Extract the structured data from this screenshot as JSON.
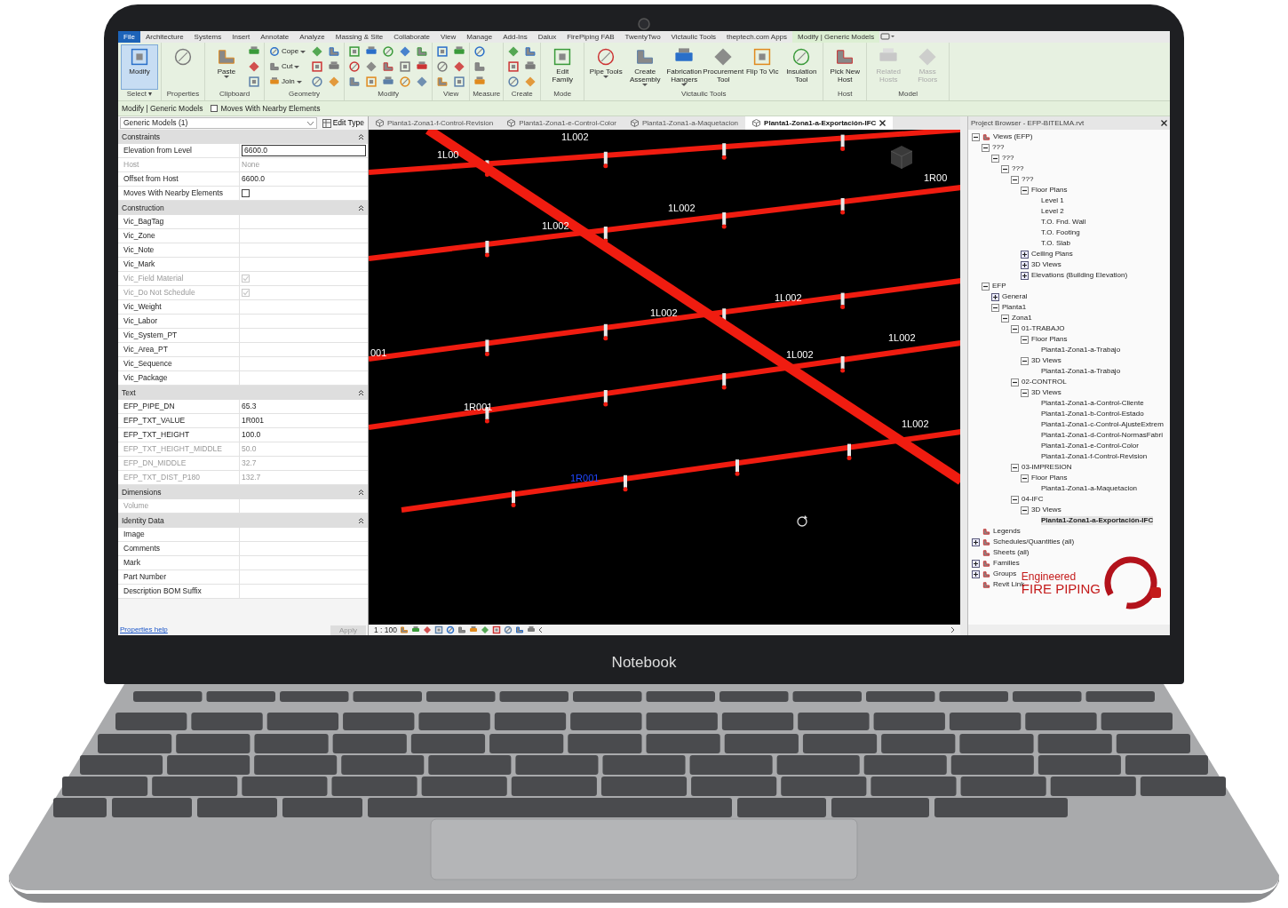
{
  "laptop": {
    "label": "Notebook"
  },
  "menu_tabs": [
    {
      "label": "File",
      "selected": false,
      "kind": "file"
    },
    {
      "label": "Architecture",
      "selected": false,
      "kind": "tab"
    },
    {
      "label": "Systems",
      "selected": false,
      "kind": "tab"
    },
    {
      "label": "Insert",
      "selected": false,
      "kind": "tab"
    },
    {
      "label": "Annotate",
      "selected": false,
      "kind": "tab"
    },
    {
      "label": "Analyze",
      "selected": false,
      "kind": "tab"
    },
    {
      "label": "Massing & Site",
      "selected": false,
      "kind": "tab"
    },
    {
      "label": "Collaborate",
      "selected": false,
      "kind": "tab"
    },
    {
      "label": "View",
      "selected": false,
      "kind": "tab"
    },
    {
      "label": "Manage",
      "selected": false,
      "kind": "tab"
    },
    {
      "label": "Add-Ins",
      "selected": false,
      "kind": "tab"
    },
    {
      "label": "Dalux",
      "selected": false,
      "kind": "tab"
    },
    {
      "label": "FirePiping FAB",
      "selected": false,
      "kind": "tab"
    },
    {
      "label": "TwentyTwo",
      "selected": false,
      "kind": "tab"
    },
    {
      "label": "Victaulic Tools",
      "selected": false,
      "kind": "tab"
    },
    {
      "label": "theptech.com Apps",
      "selected": false,
      "kind": "tab"
    },
    {
      "label": "Modify | Generic Models",
      "selected": true,
      "kind": "tab"
    }
  ],
  "ribbon_groups": [
    {
      "label": "Select ▾",
      "tools": [
        {
          "kind": "large",
          "label": "Modify",
          "selected": true,
          "disabled": false
        }
      ]
    },
    {
      "label": "Properties",
      "tools": [
        {
          "kind": "large_icon",
          "selected": false,
          "disabled": false
        }
      ]
    },
    {
      "label": "Clipboard",
      "tools": [
        {
          "kind": "large",
          "label": "Paste",
          "selected": false,
          "disabled": false,
          "menu": true
        },
        {
          "kind": "icon",
          "selected": false,
          "disabled": false
        },
        {
          "kind": "icon",
          "selected": false,
          "disabled": false
        },
        {
          "kind": "icon",
          "selected": false,
          "disabled": false
        }
      ]
    },
    {
      "label": "Geometry",
      "tools": [
        {
          "kind": "small",
          "label": "Cope",
          "selected": false,
          "disabled": false,
          "menu": true
        },
        {
          "kind": "small",
          "label": "Cut",
          "selected": false,
          "disabled": false,
          "menu": true
        },
        {
          "kind": "small",
          "label": "Join",
          "selected": false,
          "disabled": false,
          "menu": true
        },
        {
          "kind": "icon",
          "selected": false,
          "disabled": false
        },
        {
          "kind": "icon",
          "selected": false,
          "disabled": false
        },
        {
          "kind": "icon",
          "selected": false,
          "disabled": false
        },
        {
          "kind": "icon",
          "selected": false,
          "disabled": false
        },
        {
          "kind": "icon",
          "selected": false,
          "disabled": false
        },
        {
          "kind": "icon",
          "selected": false,
          "disabled": false
        }
      ]
    },
    {
      "label": "Modify",
      "tools": [
        {
          "kind": "icon",
          "selected": false,
          "disabled": false
        },
        {
          "kind": "icon",
          "selected": false,
          "disabled": false
        },
        {
          "kind": "icon",
          "selected": false,
          "disabled": false
        },
        {
          "kind": "icon",
          "selected": false,
          "disabled": false
        },
        {
          "kind": "icon",
          "selected": false,
          "disabled": false
        },
        {
          "kind": "icon",
          "selected": false,
          "disabled": false
        },
        {
          "kind": "icon",
          "selected": false,
          "disabled": false
        },
        {
          "kind": "icon",
          "selected": false,
          "disabled": false
        },
        {
          "kind": "icon",
          "selected": false,
          "disabled": false
        },
        {
          "kind": "icon",
          "selected": false,
          "disabled": false
        },
        {
          "kind": "icon",
          "selected": false,
          "disabled": false
        },
        {
          "kind": "icon",
          "selected": false,
          "disabled": false
        },
        {
          "kind": "icon",
          "selected": false,
          "disabled": false
        },
        {
          "kind": "icon",
          "selected": false,
          "disabled": false
        },
        {
          "kind": "icon",
          "selected": false,
          "disabled": false
        }
      ]
    },
    {
      "label": "View",
      "tools": [
        {
          "kind": "icon",
          "selected": false,
          "disabled": false
        },
        {
          "kind": "icon",
          "selected": false,
          "disabled": false
        },
        {
          "kind": "icon",
          "selected": false,
          "disabled": false
        },
        {
          "kind": "icon",
          "selected": false,
          "disabled": false
        },
        {
          "kind": "icon",
          "selected": false,
          "disabled": false
        },
        {
          "kind": "icon",
          "selected": false,
          "disabled": false
        }
      ]
    },
    {
      "label": "Measure",
      "tools": [
        {
          "kind": "icon",
          "selected": false,
          "disabled": false
        },
        {
          "kind": "icon",
          "selected": false,
          "disabled": false
        },
        {
          "kind": "icon",
          "selected": false,
          "disabled": false
        }
      ]
    },
    {
      "label": "Create",
      "tools": [
        {
          "kind": "icon",
          "selected": false,
          "disabled": false
        },
        {
          "kind": "icon",
          "selected": false,
          "disabled": false
        },
        {
          "kind": "icon",
          "selected": false,
          "disabled": false
        },
        {
          "kind": "icon",
          "selected": false,
          "disabled": false
        },
        {
          "kind": "icon",
          "selected": false,
          "disabled": false
        },
        {
          "kind": "icon",
          "selected": false,
          "disabled": false
        }
      ]
    },
    {
      "label": "Mode",
      "tools": [
        {
          "kind": "large",
          "label": "Edit Family",
          "selected": false,
          "disabled": false
        }
      ]
    },
    {
      "label": "Victaulic Tools",
      "tools": [
        {
          "kind": "large",
          "label": "Pipe Tools",
          "selected": false,
          "disabled": false,
          "menu": true
        },
        {
          "kind": "large",
          "label": "Create Assembly",
          "selected": false,
          "disabled": false,
          "menu": true
        },
        {
          "kind": "large",
          "label": "Fabrication Hangers",
          "selected": false,
          "disabled": false,
          "menu": true
        },
        {
          "kind": "large",
          "label": "Procurement Tool",
          "selected": false,
          "disabled": false
        },
        {
          "kind": "large",
          "label": "Flip To Vic",
          "selected": false,
          "disabled": false
        },
        {
          "kind": "large",
          "label": "Insulation Tool",
          "selected": false,
          "disabled": false
        }
      ]
    },
    {
      "label": "Host",
      "tools": [
        {
          "kind": "large",
          "label": "Pick New Host",
          "selected": false,
          "disabled": false
        }
      ]
    },
    {
      "label": "Model",
      "tools": [
        {
          "kind": "large",
          "label": "Related Hosts",
          "selected": false,
          "disabled": true
        },
        {
          "kind": "large",
          "label": "Mass Floors",
          "selected": false,
          "disabled": true
        }
      ]
    }
  ],
  "context_bar": {
    "label": "Modify | Generic Models",
    "option": {
      "label": "Moves With Nearby Elements",
      "checked": false
    }
  },
  "properties": {
    "type_selector": "Generic Models (1)",
    "edit_type": "Edit Type",
    "help_link": "Properties help",
    "apply": "Apply",
    "sections": [
      {
        "title": "Constraints",
        "rows": [
          {
            "name": "Elevation from Level",
            "value": "6600.0",
            "kind": "input",
            "disabled": false
          },
          {
            "name": "Host",
            "value": "None",
            "kind": "text",
            "disabled": true
          },
          {
            "name": "Offset from Host",
            "value": "6600.0",
            "kind": "text",
            "disabled": false
          },
          {
            "name": "Moves With Nearby Elements",
            "kind": "checkbox",
            "checked": false,
            "disabled": false
          }
        ]
      },
      {
        "title": "Construction",
        "rows": [
          {
            "name": "Vic_BagTag",
            "kind": "text",
            "disabled": false
          },
          {
            "name": "Vic_Zone",
            "kind": "text",
            "disabled": false
          },
          {
            "name": "Vic_Note",
            "kind": "text",
            "disabled": false
          },
          {
            "name": "Vic_Mark",
            "kind": "text",
            "disabled": false
          },
          {
            "name": "Vic_Field Material",
            "kind": "checkbox",
            "checked": true,
            "disabled": true
          },
          {
            "name": "Vic_Do Not Schedule",
            "kind": "checkbox",
            "checked": true,
            "disabled": true
          },
          {
            "name": "Vic_Weight",
            "kind": "text",
            "disabled": false
          },
          {
            "name": "Vic_Labor",
            "kind": "text",
            "disabled": false
          },
          {
            "name": "Vic_System_PT",
            "kind": "text",
            "disabled": false
          },
          {
            "name": "Vic_Area_PT",
            "kind": "text",
            "disabled": false
          },
          {
            "name": "Vic_Sequence",
            "kind": "text",
            "disabled": false
          },
          {
            "name": "Vic_Package",
            "kind": "text",
            "disabled": false
          }
        ]
      },
      {
        "title": "Text",
        "rows": [
          {
            "name": "EFP_PIPE_DN",
            "value": "65.3",
            "kind": "text",
            "disabled": false
          },
          {
            "name": "EFP_TXT_VALUE",
            "value": "1R001",
            "kind": "text",
            "disabled": false
          },
          {
            "name": "EFP_TXT_HEIGHT",
            "value": "100.0",
            "kind": "text",
            "disabled": false
          },
          {
            "name": "EFP_TXT_HEIGHT_MIDDLE",
            "value": "50.0",
            "kind": "text",
            "disabled": true
          },
          {
            "name": "EFP_DN_MIDDLE",
            "value": "32.7",
            "kind": "text",
            "disabled": true
          },
          {
            "name": "EFP_TXT_DIST_P180",
            "value": "132.7",
            "kind": "text",
            "disabled": true
          }
        ]
      },
      {
        "title": "Dimensions",
        "rows": [
          {
            "name": "Volume",
            "kind": "text",
            "disabled": true
          }
        ]
      },
      {
        "title": "Identity Data",
        "rows": [
          {
            "name": "Image",
            "kind": "text",
            "disabled": false
          },
          {
            "name": "Comments",
            "kind": "text",
            "disabled": false
          },
          {
            "name": "Mark",
            "kind": "text",
            "disabled": false
          },
          {
            "name": "Part Number",
            "kind": "text",
            "disabled": false
          },
          {
            "name": "Description BOM Suffix",
            "kind": "text",
            "disabled": false
          }
        ]
      }
    ]
  },
  "view_tabs": [
    {
      "label": "Planta1-Zona1-f-Control-Revision",
      "selected": false
    },
    {
      "label": "Planta1-Zona1-e-Control-Color",
      "selected": false
    },
    {
      "label": "Planta1-Zona1-a-Maquetacion",
      "selected": false
    },
    {
      "label": "Planta1-Zona1-a-Exportación-IFC",
      "selected": true
    }
  ],
  "canvas": {
    "tags": [
      {
        "text": "1L002",
        "selected": false
      },
      {
        "text": "1L002",
        "selected": false
      },
      {
        "text": "1L002",
        "selected": false
      },
      {
        "text": "1L002",
        "selected": false
      },
      {
        "text": "1L002",
        "selected": false
      },
      {
        "text": "1L002",
        "selected": false
      },
      {
        "text": "1L002",
        "selected": false
      },
      {
        "text": "1L002",
        "selected": false
      },
      {
        "text": "1L00",
        "selected": false
      },
      {
        "text": "1R00",
        "selected": false
      },
      {
        "text": "001",
        "selected": false
      },
      {
        "text": "1R001",
        "selected": false
      },
      {
        "text": "1R001",
        "selected": true
      }
    ]
  },
  "view_bar": {
    "scale": "1 : 100"
  },
  "project_browser": {
    "title": "Project Browser - EFP-BITELMA.rvt",
    "tree": [
      {
        "label": "Views (EFP)",
        "expanded": true,
        "selected": false,
        "children": [
          {
            "label": "???",
            "expanded": true,
            "selected": false,
            "children": [
              {
                "label": "???",
                "expanded": true,
                "selected": false,
                "children": [
                  {
                    "label": "???",
                    "expanded": true,
                    "selected": false,
                    "children": [
                      {
                        "label": "???",
                        "expanded": true,
                        "selected": false,
                        "children": [
                          {
                            "label": "Floor Plans",
                            "expanded": true,
                            "selected": false,
                            "children": [
                              {
                                "label": "Level 1",
                                "selected": false
                              },
                              {
                                "label": "Level 2",
                                "selected": false
                              },
                              {
                                "label": "T.O. Fnd. Wall",
                                "selected": false
                              },
                              {
                                "label": "T.O. Footing",
                                "selected": false
                              },
                              {
                                "label": "T.O. Slab",
                                "selected": false
                              }
                            ]
                          },
                          {
                            "label": "Ceiling Plans",
                            "expanded": false,
                            "selected": false
                          },
                          {
                            "label": "3D Views",
                            "expanded": false,
                            "selected": false
                          },
                          {
                            "label": "Elevations (Building Elevation)",
                            "expanded": false,
                            "selected": false
                          }
                        ]
                      }
                    ]
                  }
                ]
              }
            ]
          },
          {
            "label": "EFP",
            "expanded": true,
            "selected": false,
            "children": [
              {
                "label": "General",
                "expanded": false,
                "selected": false
              },
              {
                "label": "Planta1",
                "expanded": true,
                "selected": false,
                "children": [
                  {
                    "label": "Zona1",
                    "expanded": true,
                    "selected": false,
                    "children": [
                      {
                        "label": "01-TRABAJO",
                        "expanded": true,
                        "selected": false,
                        "children": [
                          {
                            "label": "Floor Plans",
                            "expanded": true,
                            "selected": false,
                            "children": [
                              {
                                "label": "Planta1-Zona1-a-Trabajo",
                                "selected": false
                              }
                            ]
                          },
                          {
                            "label": "3D Views",
                            "expanded": true,
                            "selected": false,
                            "children": [
                              {
                                "label": "Planta1-Zona1-a-Trabajo",
                                "selected": false
                              }
                            ]
                          }
                        ]
                      },
                      {
                        "label": "02-CONTROL",
                        "expanded": true,
                        "selected": false,
                        "children": [
                          {
                            "label": "3D Views",
                            "expanded": true,
                            "selected": false,
                            "children": [
                              {
                                "label": "Planta1-Zona1-a-Control-Cliente",
                                "selected": false
                              },
                              {
                                "label": "Planta1-Zona1-b-Control-Estado",
                                "selected": false
                              },
                              {
                                "label": "Planta1-Zona1-c-Control-AjusteExtrem",
                                "selected": false
                              },
                              {
                                "label": "Planta1-Zona1-d-Control-NormasFabri",
                                "selected": false
                              },
                              {
                                "label": "Planta1-Zona1-e-Control-Color",
                                "selected": false
                              },
                              {
                                "label": "Planta1-Zona1-f-Control-Revision",
                                "selected": false
                              }
                            ]
                          }
                        ]
                      },
                      {
                        "label": "03-IMPRESION",
                        "expanded": true,
                        "selected": false,
                        "children": [
                          {
                            "label": "Floor Plans",
                            "expanded": true,
                            "selected": false,
                            "children": [
                              {
                                "label": "Planta1-Zona1-a-Maquetacion",
                                "selected": false
                              }
                            ]
                          }
                        ]
                      },
                      {
                        "label": "04-IFC",
                        "expanded": true,
                        "selected": false,
                        "children": [
                          {
                            "label": "3D Views",
                            "expanded": true,
                            "selected": false,
                            "children": [
                              {
                                "label": "Planta1-Zona1-a-Exportación-IFC",
                                "selected": true
                              }
                            ]
                          }
                        ]
                      }
                    ]
                  }
                ]
              }
            ]
          }
        ]
      },
      {
        "label": "Legends",
        "selected": false
      },
      {
        "label": "Schedules/Quantities (all)",
        "expanded": false,
        "selected": false
      },
      {
        "label": "Sheets (all)",
        "selected": false
      },
      {
        "label": "Families",
        "expanded": false,
        "selected": false
      },
      {
        "label": "Groups",
        "expanded": false,
        "selected": false
      },
      {
        "label": "Revit Link",
        "selected": false
      }
    ]
  },
  "logo": {
    "line1": "Engineered",
    "line2": "FIRE PIPING"
  }
}
